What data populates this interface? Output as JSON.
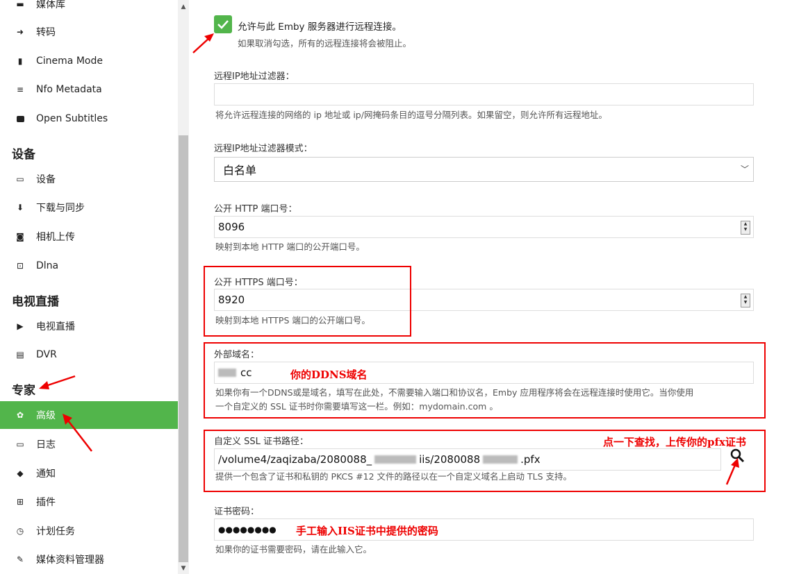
{
  "sidebar": {
    "top_partial": "媒体库",
    "items_group1": [
      {
        "label": "转码",
        "icon": "transcode-icon"
      },
      {
        "label": "Cinema Mode",
        "icon": "film-icon"
      },
      {
        "label": "Nfo Metadata",
        "icon": "list-icon"
      },
      {
        "label": "Open Subtitles",
        "icon": "cc-icon"
      }
    ],
    "section_devices": "设备",
    "items_devices": [
      {
        "label": "设备",
        "icon": "devices-icon"
      },
      {
        "label": "下载与同步",
        "icon": "download-icon"
      },
      {
        "label": "相机上传",
        "icon": "camera-icon"
      },
      {
        "label": "Dlna",
        "icon": "dlna-icon"
      }
    ],
    "section_livetv": "电视直播",
    "items_livetv": [
      {
        "label": "电视直播",
        "icon": "live-tv-icon"
      },
      {
        "label": "DVR",
        "icon": "dvr-icon"
      }
    ],
    "section_expert": "专家",
    "items_expert": [
      {
        "label": "高级",
        "icon": "gear-icon",
        "active": true
      },
      {
        "label": "日志",
        "icon": "folder-icon"
      },
      {
        "label": "通知",
        "icon": "bell-icon"
      },
      {
        "label": "插件",
        "icon": "plugin-icon"
      },
      {
        "label": "计划任务",
        "icon": "clock-icon"
      },
      {
        "label": "媒体资料管理器",
        "icon": "wrench-icon"
      }
    ]
  },
  "form": {
    "remote_access_label": "允许与此 Emby 服务器进行远程连接。",
    "remote_access_help": "如果取消勾选，所有的远程连接将会被阻止。",
    "ip_filter_label": "远程IP地址过滤器：",
    "ip_filter_value": "",
    "ip_filter_help": "将允许远程连接的网络的 ip 地址或 ip/网掩码条目的逗号分隔列表。如果留空，则允许所有远程地址。",
    "ip_filter_mode_label": "远程IP地址过滤器模式：",
    "ip_filter_mode_value": "白名单",
    "http_port_label": "公开 HTTP 端口号：",
    "http_port_value": "8096",
    "http_port_help": "映射到本地 HTTP 端口的公开端口号。",
    "https_port_label": "公开 HTTPS 端口号：",
    "https_port_value": "8920",
    "https_port_help": "映射到本地 HTTPS 端口的公开端口号。",
    "domain_label": "外部域名：",
    "domain_value": "cc",
    "domain_help_1": "如果你有一个DDNS或是域名，填写在此处，不需要输入端口和协议名，Emby 应用程序将会在远程连接时使用它。当你使用",
    "domain_help_2": "一个自定义的 SSL 证书时你需要填写这一栏。例如：mydomain.com 。",
    "ssl_path_label": "自定义 SSL 证书路径：",
    "ssl_path_value_a": "/volume4/zaqizaba/2080088_",
    "ssl_path_value_b": "iis/2080088",
    "ssl_path_value_c": ".pfx",
    "ssl_path_help": "提供一个包含了证书和私钥的 PKCS #12 文件的路径以在一个自定义域名上启动 TLS 支持。",
    "cert_password_label": "证书密码：",
    "cert_password_value": "●●●●●●●●",
    "cert_password_help": "如果你的证书需要密码，请在此输入它。"
  },
  "annotations": {
    "ddns_note": "你的DDNS域名",
    "pfx_note": "点一下查找，上传你的pfx证书",
    "password_note": "手工输入IIS证书中提供的密码"
  },
  "colors": {
    "accent": "#52b54b",
    "annotation": "#ee0000"
  }
}
